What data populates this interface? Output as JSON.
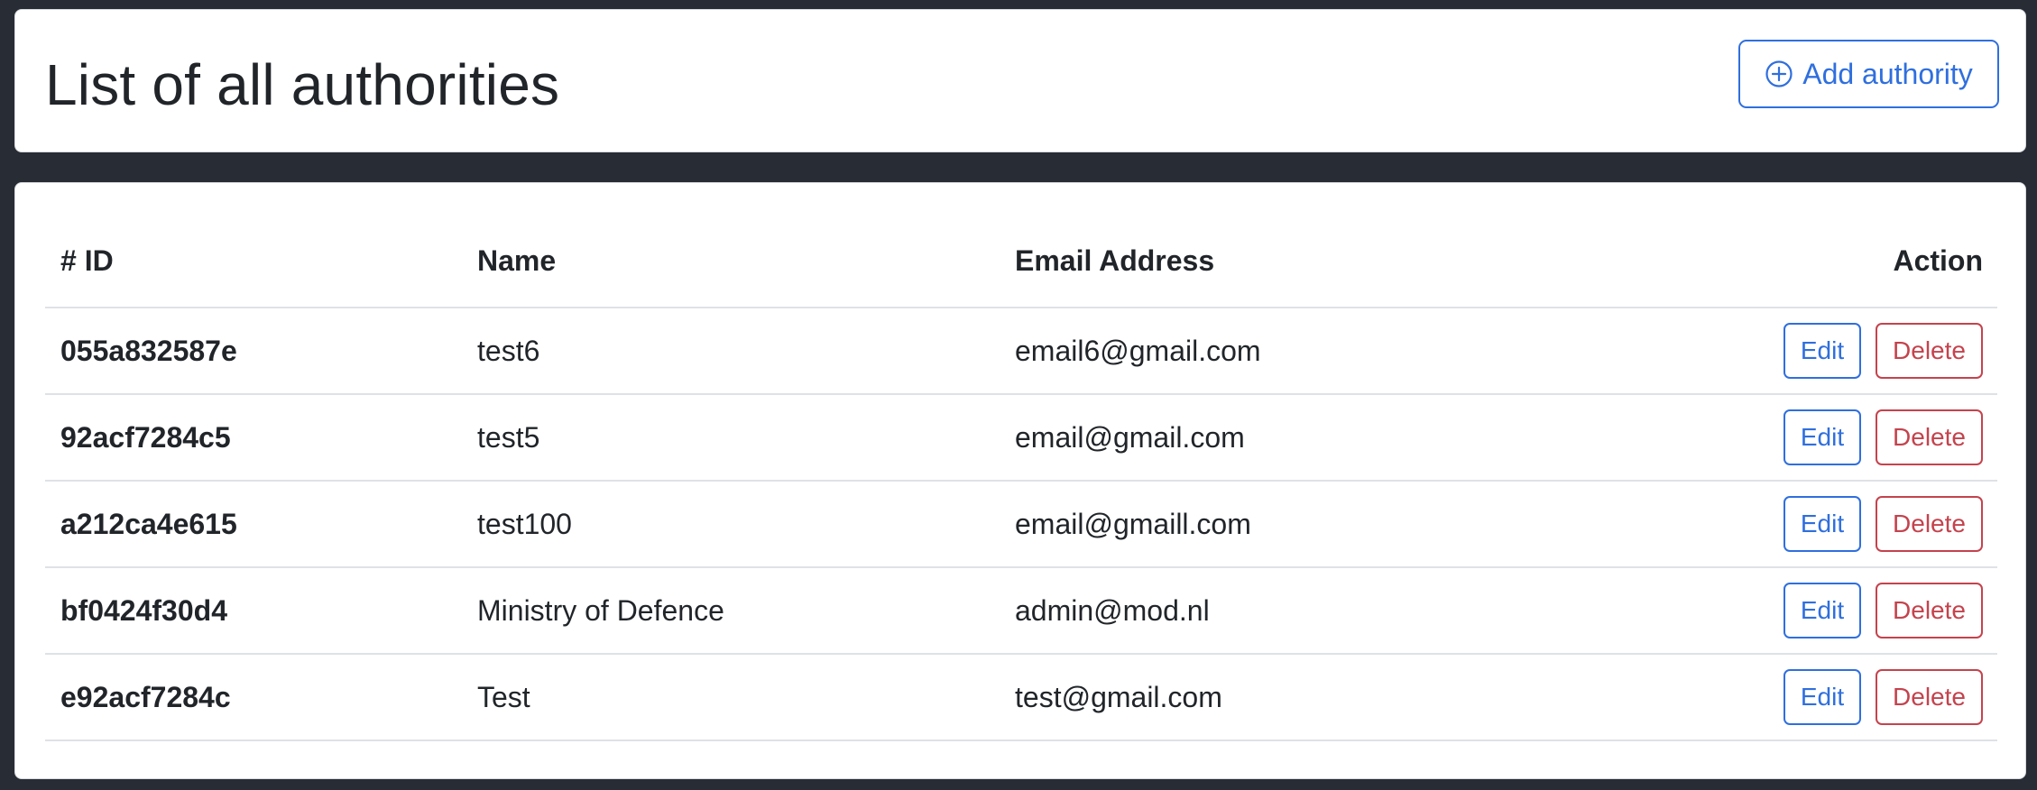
{
  "header": {
    "title": "List of all authorities",
    "add_button_label": "Add authority"
  },
  "table": {
    "columns": [
      "# ID",
      "Name",
      "Email Address",
      "Action"
    ],
    "rows": [
      {
        "id": "055a832587e",
        "name": "test6",
        "email": "email6@gmail.com",
        "edit_label": "Edit",
        "delete_label": "Delete"
      },
      {
        "id": "92acf7284c5",
        "name": "test5",
        "email": "email@gmail.com",
        "edit_label": "Edit",
        "delete_label": "Delete"
      },
      {
        "id": "a212ca4e615",
        "name": "test100",
        "email": "email@gmaill.com",
        "edit_label": "Edit",
        "delete_label": "Delete"
      },
      {
        "id": "bf0424f30d4",
        "name": "Ministry of Defence",
        "email": "admin@mod.nl",
        "edit_label": "Edit",
        "delete_label": "Delete"
      },
      {
        "id": "e92acf7284c",
        "name": "Test",
        "email": "test@gmail.com",
        "edit_label": "Edit",
        "delete_label": "Delete"
      }
    ]
  },
  "icons": {
    "add": "plus-circle-icon"
  },
  "colors": {
    "background": "#282c34",
    "primary": "#2f6fde",
    "danger": "#c4434d",
    "text": "#212529"
  }
}
